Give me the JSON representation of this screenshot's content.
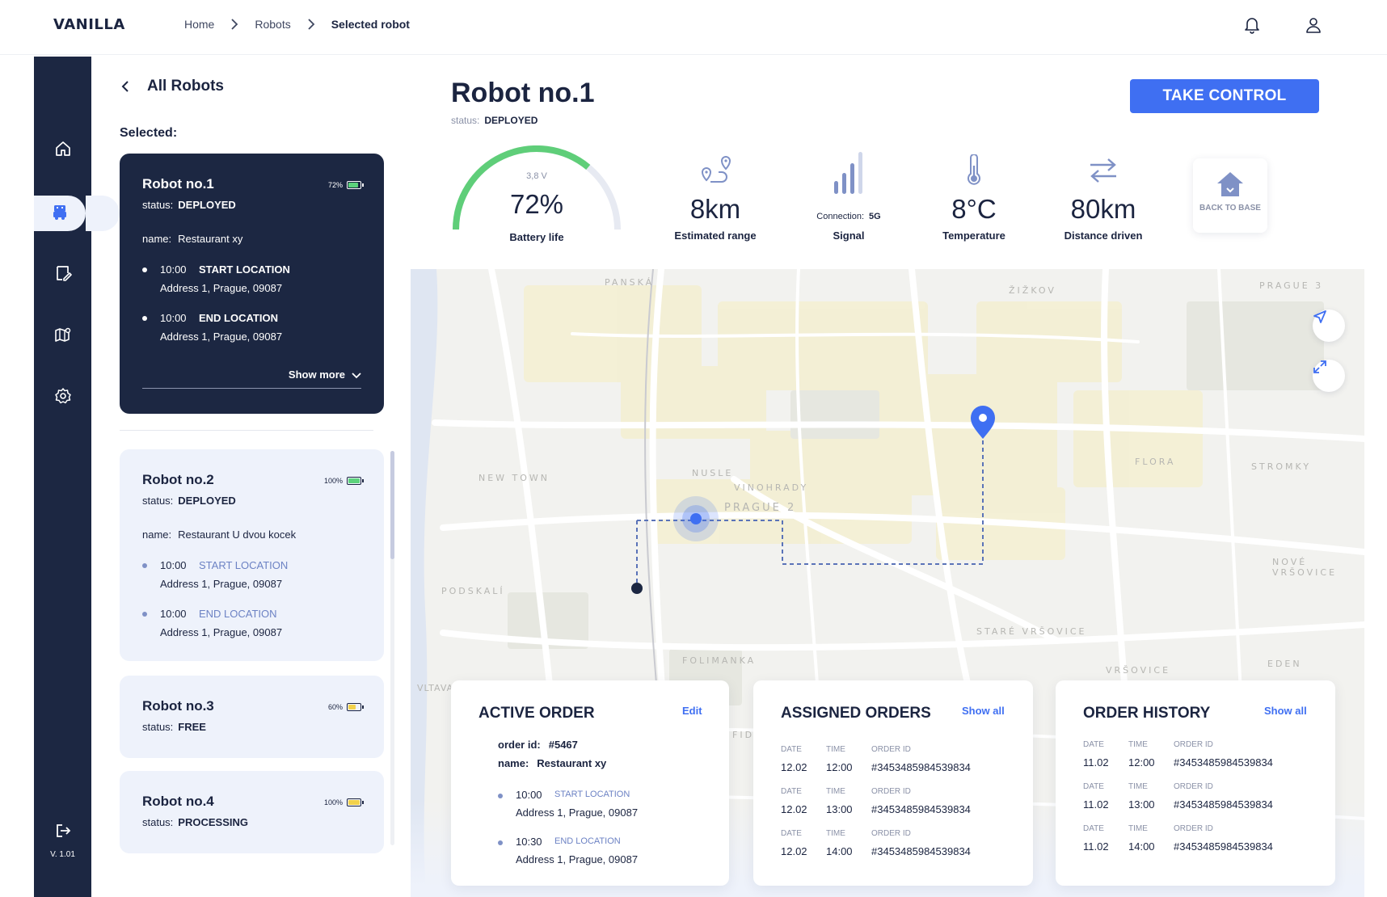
{
  "app": {
    "logo": "VANILLA",
    "version": "V. 1.01"
  },
  "breadcrumb": [
    "Home",
    "Robots",
    "Selected robot"
  ],
  "list": {
    "back_label": "All Robots",
    "selected_label": "Selected:",
    "show_more": "Show more",
    "robots": [
      {
        "title": "Robot no.1",
        "status_key": "status:",
        "status": "DEPLOYED",
        "battery": "72%",
        "name_key": "name:",
        "name": "Restaurant xy",
        "start_time": "10:00",
        "start_label": "START LOCATION",
        "start_address": "Address 1, Prague, 09087",
        "end_time": "10:00",
        "end_label": "END LOCATION",
        "end_address": "Address 1, Prague, 09087"
      },
      {
        "title": "Robot no.2",
        "status_key": "status:",
        "status": "DEPLOYED",
        "battery": "100%",
        "name_key": "name:",
        "name": "Restaurant U dvou kocek",
        "start_time": "10:00",
        "start_label": "START LOCATION",
        "start_address": "Address 1, Prague, 09087",
        "end_time": "10:00",
        "end_label": "END LOCATION",
        "end_address": "Address 1, Prague, 09087"
      },
      {
        "title": "Robot no.3",
        "status_key": "status:",
        "status": "FREE",
        "battery": "60%"
      },
      {
        "title": "Robot no.4",
        "status_key": "status:",
        "status": "PROCESSING",
        "battery": "100%"
      }
    ]
  },
  "robot": {
    "title": "Robot no.1",
    "status_key": "status:",
    "status": "DEPLOYED",
    "take_control": "TAKE CONTROL"
  },
  "stats": {
    "battery": {
      "voltage": "3,8 V",
      "value": "72%",
      "label": "Battery life",
      "level": 0.72
    },
    "range": {
      "value": "8km",
      "label": "Estimated range"
    },
    "signal": {
      "connection_key": "Connection:",
      "connection": "5G",
      "label": "Signal"
    },
    "temperature": {
      "value": "8°C",
      "label": "Temperature"
    },
    "distance": {
      "value": "80km",
      "label": "Distance driven"
    },
    "back_to_base": "BACK TO BASE"
  },
  "map": {
    "labels": [
      "PANSKÁ",
      "ŽIŽKOV",
      "PRAGUE 3",
      "NEW TOWN",
      "NUSLE",
      "VINOHRADY",
      "PRAGUE 2",
      "FLORA",
      "STROMKY",
      "NOVÉ VRŠOVICE",
      "PODSKALÍ",
      "STARÉ VRŠOVICE",
      "FOLIMANKA",
      "VRŠOVICE",
      "EDEN",
      "Vltava",
      "FID"
    ]
  },
  "active_order": {
    "title": "ACTIVE ORDER",
    "edit": "Edit",
    "order_id_key": "order id:",
    "order_id": "#5467",
    "name_key": "name:",
    "name": "Restaurant xy",
    "start_time": "10:00",
    "start_label": "START LOCATION",
    "start_address": "Address 1, Prague, 09087",
    "end_time": "10:30",
    "end_label": "END LOCATION",
    "end_address": "Address 1, Prague, 09087"
  },
  "assigned_orders": {
    "title": "ASSIGNED ORDERS",
    "show_all": "Show all",
    "headers": [
      "DATE",
      "TIME",
      "ORDER ID"
    ],
    "rows": [
      [
        "12.02",
        "12:00",
        "#3453485984539834"
      ],
      [
        "12.02",
        "13:00",
        "#3453485984539834"
      ],
      [
        "12.02",
        "14:00",
        "#3453485984539834"
      ]
    ]
  },
  "order_history": {
    "title": "ORDER HISTORY",
    "show_all": "Show all",
    "headers": [
      "DATE",
      "TIME",
      "ORDER ID"
    ],
    "rows": [
      [
        "11.02",
        "12:00",
        "#3453485984539834"
      ],
      [
        "11.02",
        "13:00",
        "#3453485984539834"
      ],
      [
        "11.02",
        "14:00",
        "#3453485984539834"
      ]
    ]
  },
  "colors": {
    "navy": "#1c2742",
    "accent": "#3f6ff2",
    "battery_green": "#5cd37c",
    "battery_yellow": "#f2d24b",
    "light_card": "#eef2fb"
  },
  "icons": {
    "nav": [
      "home-icon",
      "robot-icon",
      "orders-icon",
      "map-icon",
      "settings-icon",
      "logout-icon"
    ],
    "top": [
      "bell-icon",
      "user-icon"
    ]
  }
}
